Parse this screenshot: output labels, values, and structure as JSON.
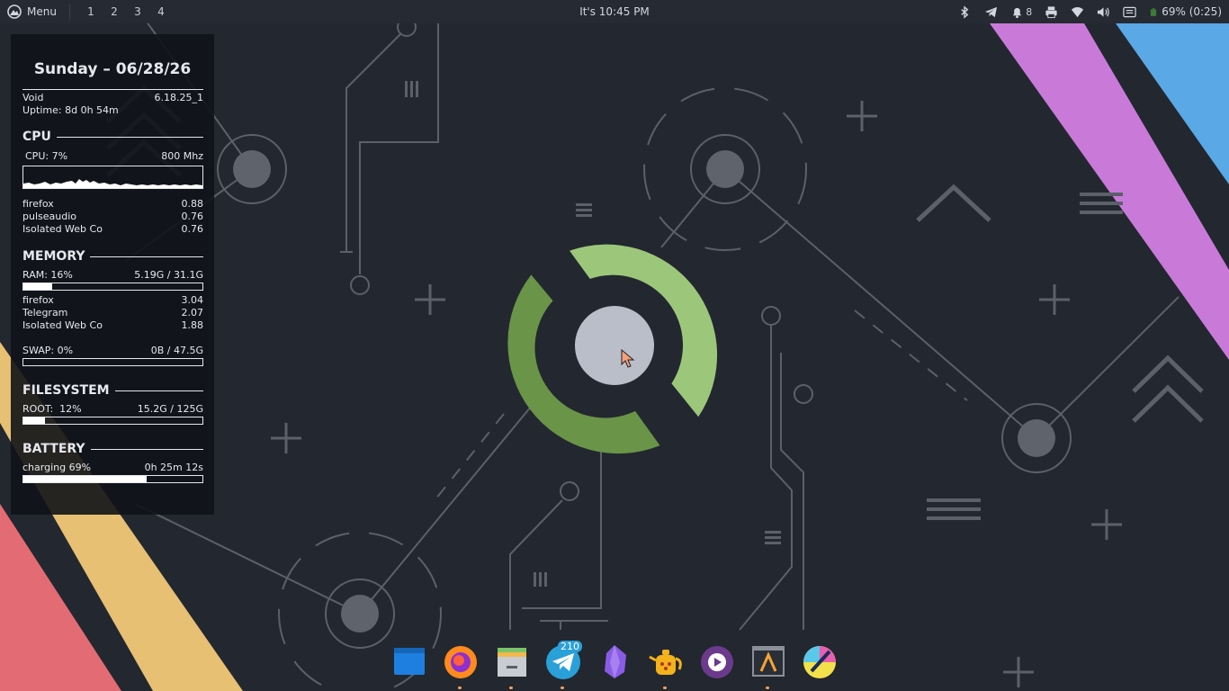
{
  "panel": {
    "menu_label": "Menu",
    "workspaces": [
      "1",
      "2",
      "3",
      "4"
    ],
    "clock": "It's 10:45 PM",
    "tray": {
      "icons": [
        "bluetooth-icon",
        "telegram-icon",
        "notifications-icon",
        "printer-icon",
        "wifi-icon",
        "volume-icon",
        "keyboard-icon",
        "battery-icon"
      ],
      "notification_count": "8",
      "battery_text": "69% (0:25)"
    }
  },
  "conky": {
    "date": "Sunday – 06/28/26",
    "os": "Void",
    "kernel": "6.18.25_1",
    "uptime": "Uptime: 8d 0h 54m",
    "cpu": {
      "title": "CPU",
      "usage": "CPU: 7%",
      "freq": "800 Mhz",
      "processes": [
        {
          "name": "firefox",
          "value": "0.88"
        },
        {
          "name": "pulseaudio",
          "value": "0.76"
        },
        {
          "name": "Isolated Web Co",
          "value": "0.76"
        }
      ]
    },
    "memory": {
      "title": "MEMORY",
      "ram_label": "RAM: 16%",
      "ram_value": "5.19G / 31.1G",
      "ram_fraction": 0.16,
      "processes": [
        {
          "name": "firefox",
          "value": "3.04"
        },
        {
          "name": "Telegram",
          "value": "2.07"
        },
        {
          "name": "Isolated Web Co",
          "value": "1.88"
        }
      ],
      "swap_label": "SWAP: 0%",
      "swap_value": "0B / 47.5G",
      "swap_fraction": 0.0
    },
    "filesystem": {
      "title": "FILESYSTEM",
      "root_label": "ROOT:  12%",
      "root_value": "15.2G / 125G",
      "root_fraction": 0.12
    },
    "battery": {
      "title": "BATTERY",
      "status": "charging 69%",
      "time": "0h 25m 12s",
      "fraction": 0.69
    }
  },
  "dock": {
    "apps": [
      "files-app-icon",
      "firefox-icon",
      "file-manager-icon",
      "telegram-icon",
      "obsidian-icon",
      "teapot-app-icon",
      "media-player-icon",
      "text-editor-icon",
      "color-picker-icon"
    ],
    "telegram_badge": "210"
  },
  "colors": {
    "background": "#232730",
    "panel": "#262a33",
    "accent_green_light": "#9cc77a",
    "accent_green_dark": "#6a9447",
    "stripe_pink": "#c97ad9",
    "stripe_blue": "#5aa8e6",
    "stripe_yellow": "#e7c074",
    "stripe_red": "#e36c74"
  }
}
